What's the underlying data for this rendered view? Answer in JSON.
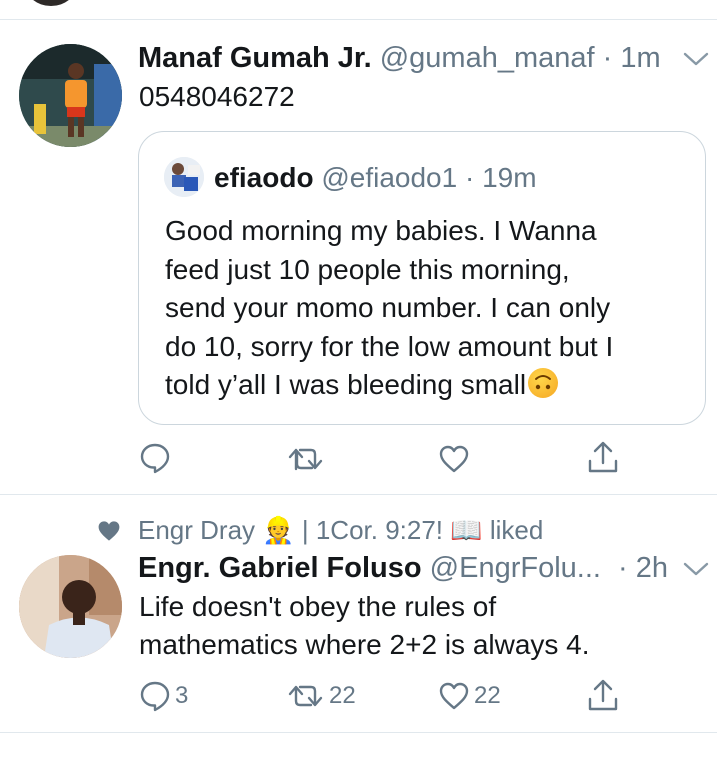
{
  "tweets": [
    {
      "name": "Manaf Gumah Jr.",
      "handle": "@gumah_manaf",
      "separator": "·",
      "time": "1m",
      "text": "0548046272",
      "quoted": {
        "name": "efiaodo",
        "handle": "@efiaodo1",
        "separator": "·",
        "time": "19m",
        "lines": [
          "Good morning my babies. I Wanna",
          "feed just 10 people this morning,",
          "send your momo number. I can only",
          "do 10, sorry for the low amount but I",
          "told y’all I was bleeding small"
        ]
      },
      "actions": {
        "reply": "",
        "retweet": "",
        "like": ""
      }
    },
    {
      "social_context": "Engr Dray 👷 | 1Cor. 9:27! 📖 liked",
      "name": "Engr. Gabriel Foluso",
      "handle": "@EngrFolu...",
      "separator": "·",
      "time": "2h",
      "lines": [
        "Life doesn't obey the rules of",
        "mathematics where 2+2 is always 4."
      ],
      "actions": {
        "reply": "3",
        "retweet": "22",
        "like": "22"
      }
    }
  ],
  "icons": [
    "reply-icon",
    "retweet-icon",
    "like-icon",
    "share-icon",
    "chevron-down-icon",
    "heart-icon"
  ],
  "colors": {
    "text": "#14171a",
    "secondary": "#657786",
    "border": "#e1e8ed"
  }
}
